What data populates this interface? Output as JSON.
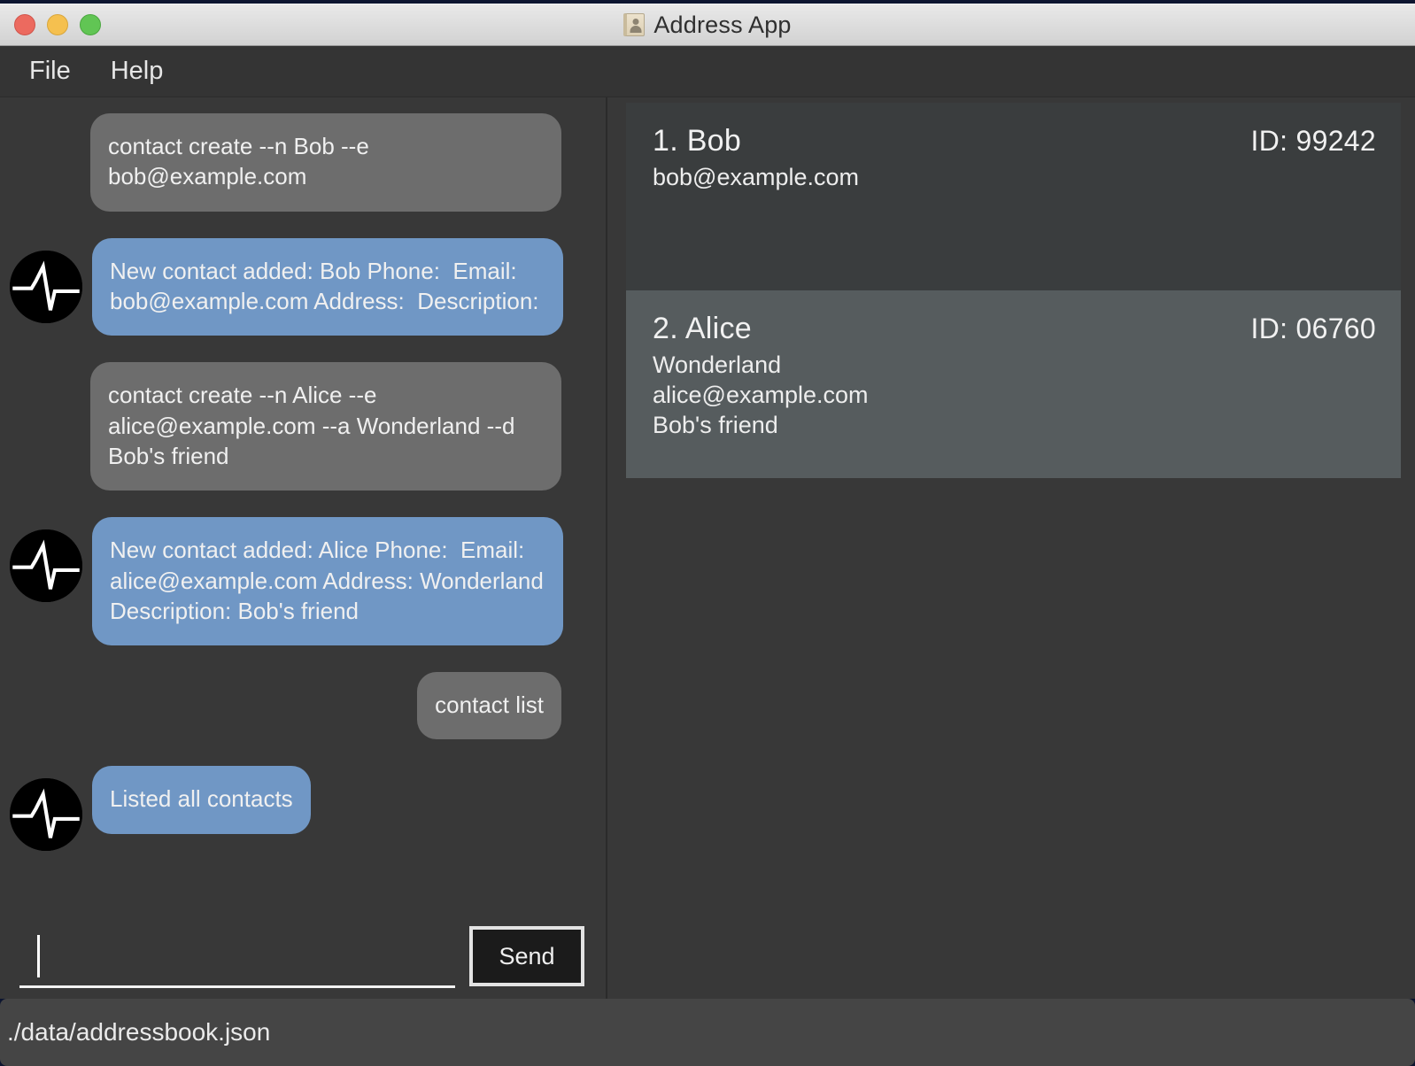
{
  "window": {
    "title": "Address App",
    "icon": "address-book-icon",
    "traffic_lights": [
      {
        "name": "close",
        "color": "#ec6a5f"
      },
      {
        "name": "minimize",
        "color": "#f5c04f"
      },
      {
        "name": "maximize",
        "color": "#61c554"
      }
    ]
  },
  "menubar": {
    "items": [
      {
        "label": "File"
      },
      {
        "label": "Help"
      }
    ]
  },
  "chat": {
    "avatar_icon": "pulse-waveform-avatar-icon",
    "messages": [
      {
        "role": "user",
        "text": "contact create --n Bob --e bob@example.com",
        "has_avatar": false
      },
      {
        "role": "bot",
        "text": "New contact added: Bob Phone:  Email: bob@example.com Address:  Description:",
        "has_avatar": true
      },
      {
        "role": "user",
        "text": "contact create --n Alice --e alice@example.com --a Wonderland --d Bob's friend",
        "has_avatar": false
      },
      {
        "role": "bot",
        "text": "New contact added: Alice Phone:  Email: alice@example.com Address: Wonderland Description: Bob's friend",
        "has_avatar": true
      },
      {
        "role": "user",
        "text": "contact list",
        "has_avatar": false
      },
      {
        "role": "bot",
        "text": "Listed all contacts",
        "has_avatar": true
      }
    ]
  },
  "input": {
    "value": "",
    "placeholder": "",
    "send_label": "Send"
  },
  "contacts": {
    "items": [
      {
        "index": "1.",
        "name": "Bob",
        "id_label": "ID: 99242",
        "details": [
          "bob@example.com"
        ],
        "selected": false
      },
      {
        "index": "2.",
        "name": "Alice",
        "id_label": "ID: 06760",
        "details": [
          "Wonderland",
          "alice@example.com",
          "Bob's friend"
        ],
        "selected": true
      }
    ]
  },
  "statusbar": {
    "path": "./data/addressbook.json"
  },
  "colors": {
    "app_background": "#383838",
    "user_bubble": "#6d6d6d",
    "bot_bubble": "#7097c5",
    "contact_row": "#3a3d3e",
    "contact_row_selected": "#565c5e",
    "statusbar": "#454545",
    "menubar": "#343434"
  }
}
